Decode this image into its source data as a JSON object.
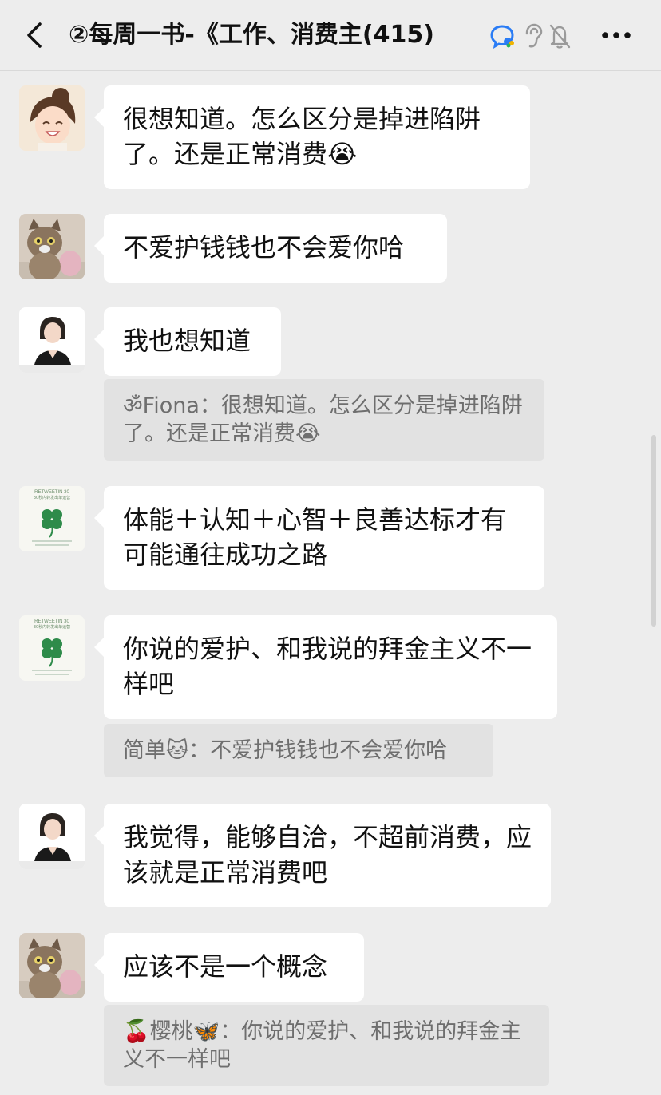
{
  "header": {
    "title": "②每周一书-《工作、消费主",
    "member_count": "(415)",
    "icons": [
      "back-icon",
      "chat-search-icon",
      "ear-icon",
      "mute-bell-icon",
      "more-icon"
    ]
  },
  "messages": [
    {
      "avatar": "girl-avatar",
      "text": "很想知道。怎么区分是掉进陷阱了。还是正常消费😭"
    },
    {
      "avatar": "cat-avatar",
      "text": "不爱护钱钱也不会爱你哈"
    },
    {
      "avatar": "woman-suit-avatar",
      "text": "我也想知道",
      "quote": "ॐFiona：很想知道。怎么区分是掉进陷阱了。还是正常消费😭"
    },
    {
      "avatar": "clover-avatar",
      "text": "体能＋认知＋心智＋良善达标才有可能通往成功之路"
    },
    {
      "avatar": "clover-avatar",
      "text": "你说的爱护、和我说的拜金主义不一样吧",
      "quote": "简单🐱：不爱护钱钱也不会爱你哈"
    },
    {
      "avatar": "woman-suit-avatar",
      "text": "我觉得，能够自洽，不超前消费，应该就是正常消费吧"
    },
    {
      "avatar": "cat-avatar",
      "text": "应该不是一个概念",
      "quote": "🍒樱桃🦋：你说的爱护、和我说的拜金主义不一样吧"
    }
  ],
  "clover_avatar": {
    "line1": "RETWEETIN 30",
    "line2": "30秒内转发出单运营"
  },
  "colors": {
    "background": "#ededed",
    "bubble": "#ffffff",
    "quote": "#e2e2e2",
    "accent": "#2a7cf5"
  }
}
